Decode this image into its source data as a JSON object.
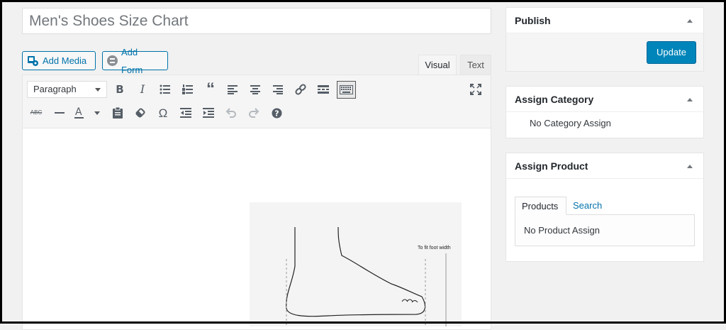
{
  "post": {
    "title": "Men's Shoes Size Chart"
  },
  "media_buttons": {
    "add_media": "Add Media",
    "add_form": "Add Form"
  },
  "editor_tabs": {
    "visual": "Visual",
    "text": "Text"
  },
  "toolbar": {
    "format_select": "Paragraph",
    "row1_icons": [
      "bold-icon",
      "italic-icon",
      "bulleted-list-icon",
      "numbered-list-icon",
      "blockquote-icon",
      "align-left-icon",
      "align-center-icon",
      "align-right-icon",
      "link-icon",
      "read-more-icon",
      "toolbar-toggle-icon",
      "fullscreen-icon"
    ],
    "row2_icons": [
      "strikethrough-icon",
      "horizontal-line-icon",
      "text-color-icon",
      "paste-text-icon",
      "clear-formatting-icon",
      "special-character-icon",
      "outdent-icon",
      "indent-icon",
      "undo-icon",
      "redo-icon",
      "help-icon"
    ]
  },
  "content_image": {
    "label": "To fit foot width"
  },
  "publish_box": {
    "title": "Publish",
    "update_button": "Update"
  },
  "category_box": {
    "title": "Assign Category",
    "empty_text": "No Category Assign"
  },
  "product_box": {
    "title": "Assign Product",
    "tabs": [
      "Products",
      "Search"
    ],
    "empty_text": "No Product Assign"
  },
  "colors": {
    "accent_blue": "#0073aa",
    "button_primary": "#0085ba",
    "background": "#f1f1f1"
  }
}
